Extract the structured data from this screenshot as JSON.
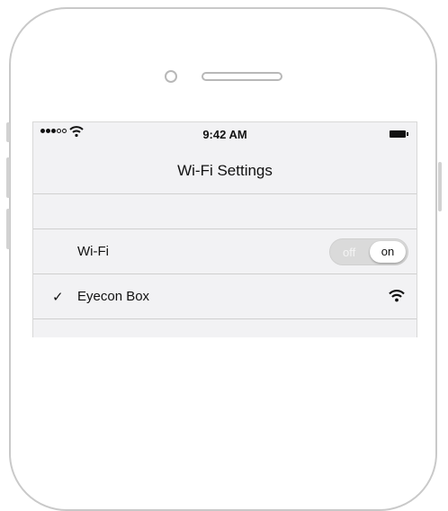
{
  "status_bar": {
    "time": "9:42 AM"
  },
  "nav": {
    "title": "Wi-Fi Settings"
  },
  "wifi_row": {
    "label": "Wi-Fi",
    "toggle_off_label": "off",
    "toggle_on_label": "on",
    "state": "on"
  },
  "network_row": {
    "checkmark": "✓",
    "name": "Eyecon Box",
    "icon": "wifi-signal-icon"
  }
}
